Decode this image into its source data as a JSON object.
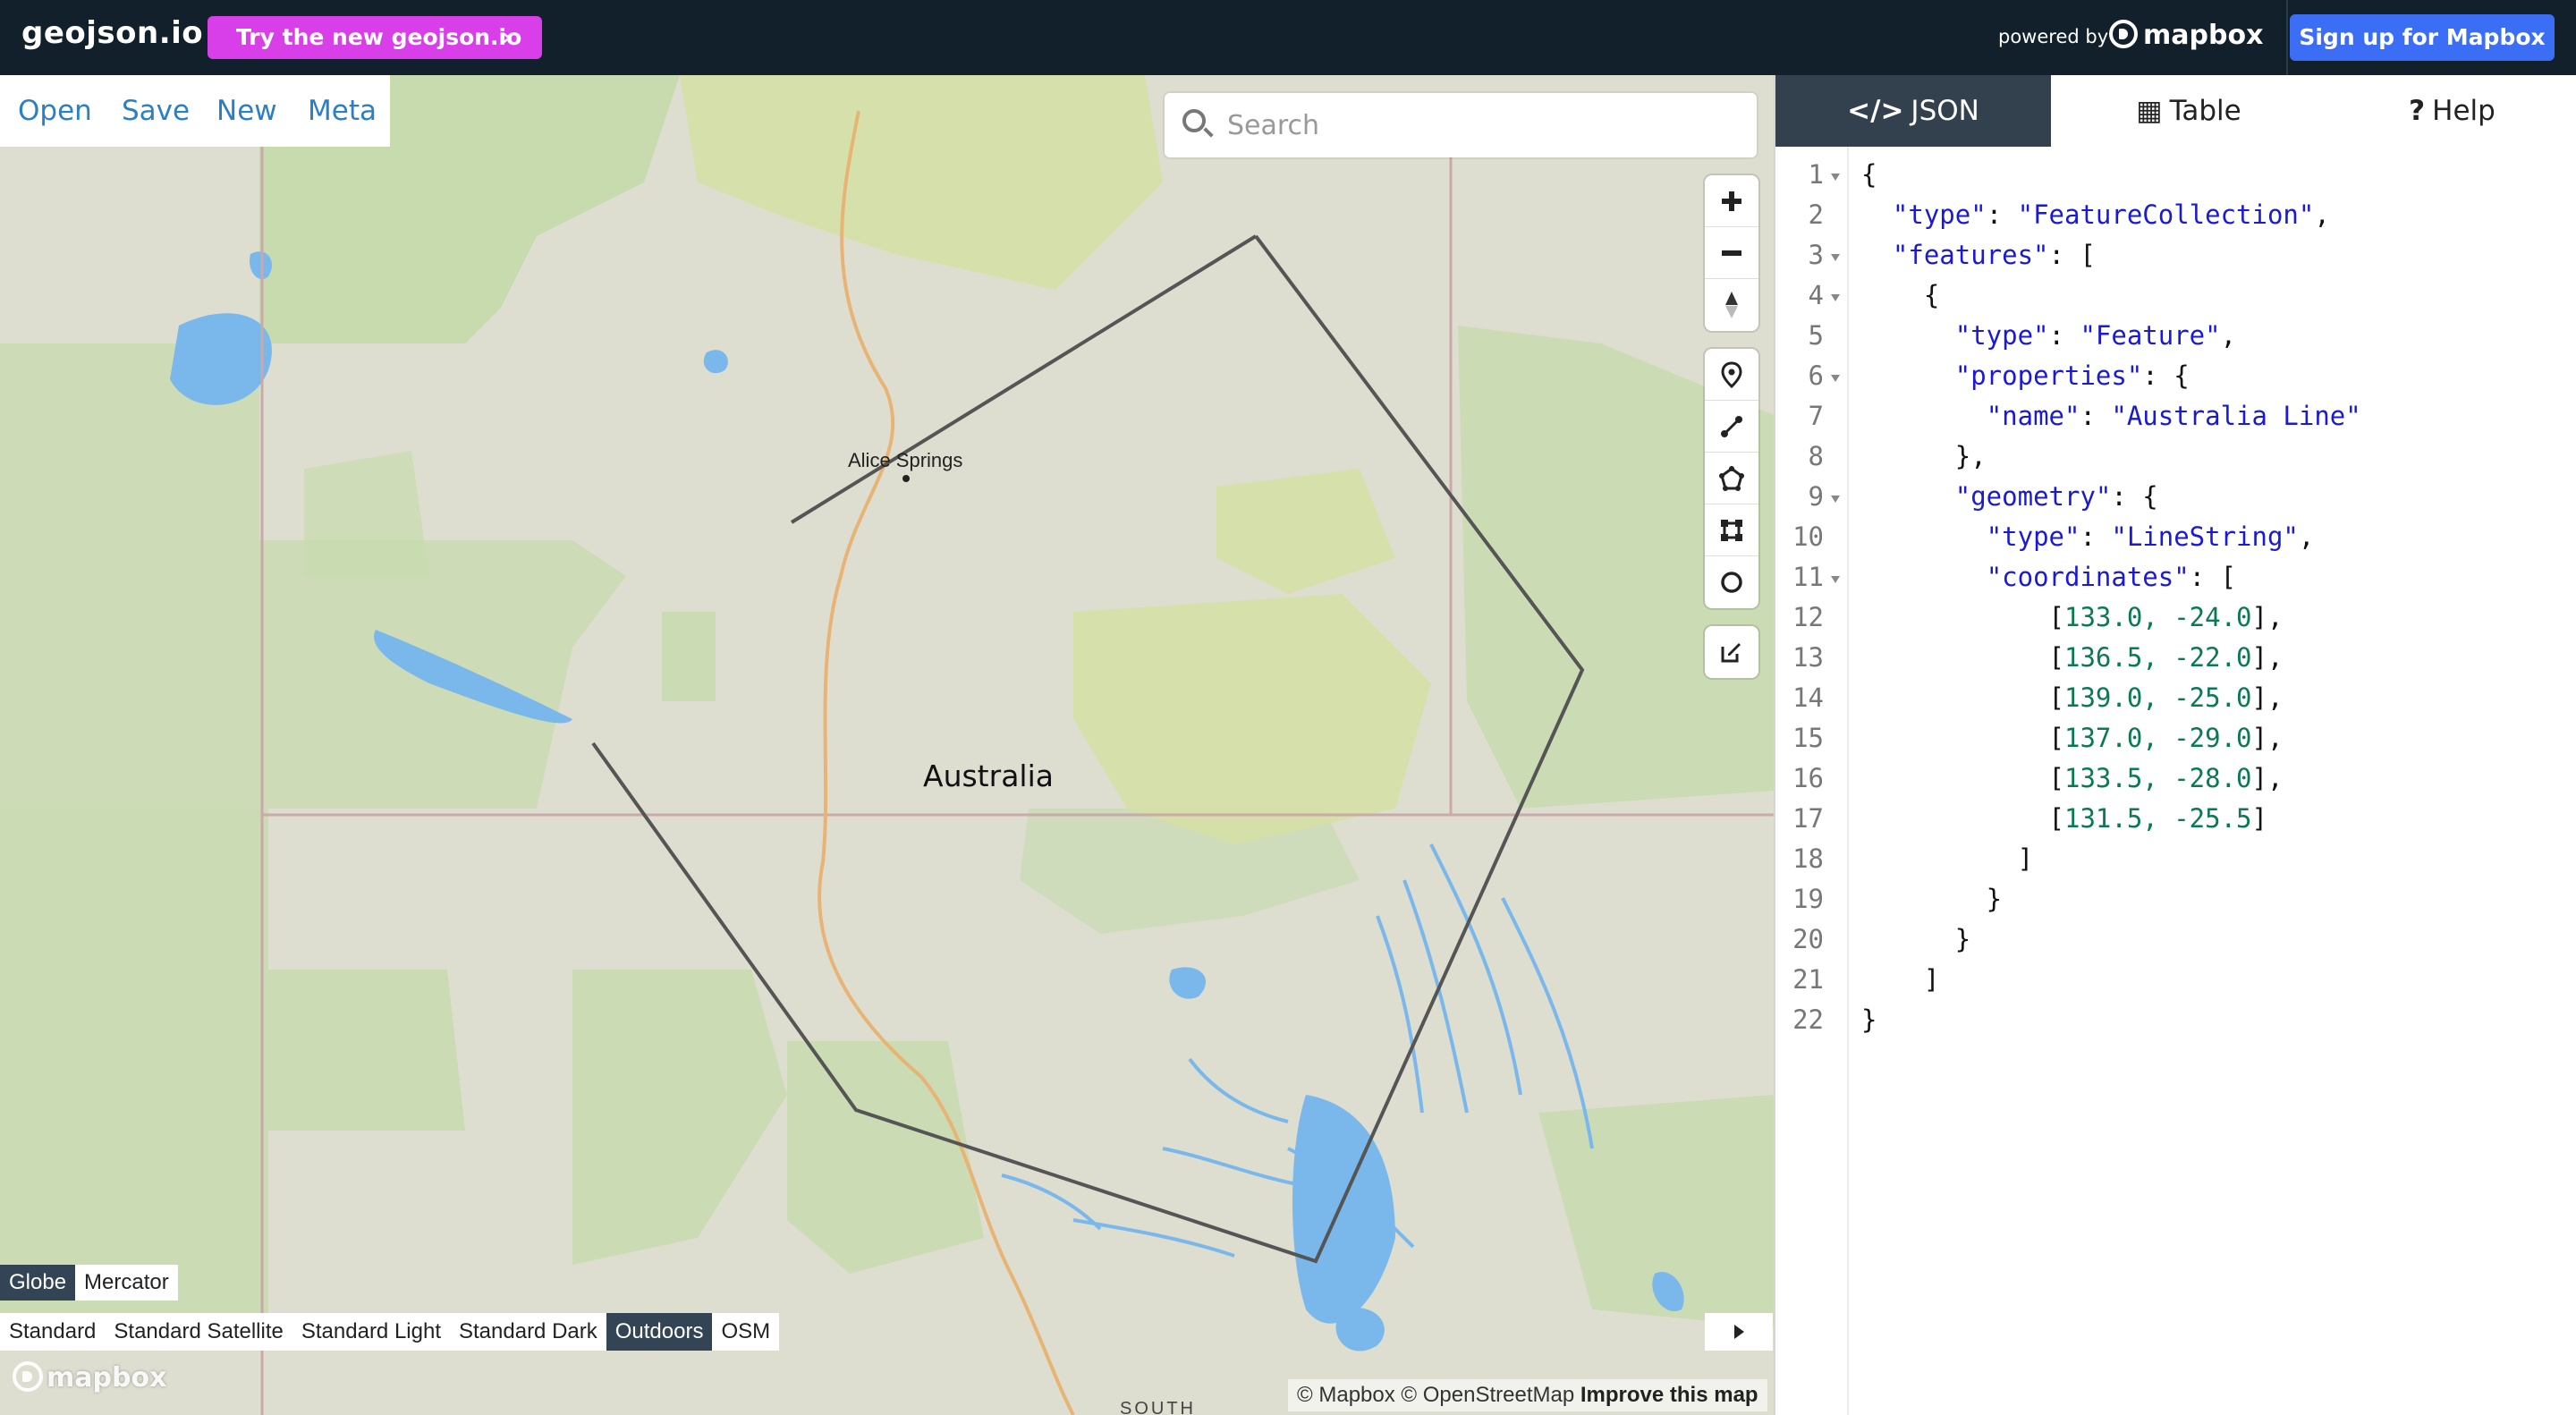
{
  "topbar": {
    "app_title": "geojson.io",
    "try_button": "Try the new geojson.io",
    "powered_by": "powered by",
    "mapbox_logo_text": "mapbox",
    "signup_button": "Sign up for Mapbox",
    "colors": {
      "bar": "#12202b",
      "try": "#d93fe8",
      "signup": "#3b6ef5"
    }
  },
  "file_menu": {
    "open": "Open",
    "save": "Save",
    "new": "New",
    "meta": "Meta"
  },
  "search": {
    "placeholder": "Search",
    "value": ""
  },
  "map": {
    "labels": {
      "city": "Alice Springs",
      "country": "Australia",
      "bottom": "SOUTH"
    },
    "projection": {
      "globe": "Globe",
      "mercator": "Mercator",
      "active": "Globe"
    },
    "styles": [
      "Standard",
      "Standard Satellite",
      "Standard Light",
      "Standard Dark",
      "Outdoors",
      "OSM"
    ],
    "active_style": "Outdoors",
    "watermark": "mapbox",
    "attribution": {
      "mapbox": "© Mapbox",
      "osm": "© OpenStreetMap",
      "improve": "Improve this map"
    },
    "controls": [
      "zoom-in-icon",
      "zoom-out-icon",
      "compass-icon",
      "marker-icon",
      "line-icon",
      "polygon-icon",
      "rectangle-icon",
      "circle-icon",
      "edit-icon"
    ]
  },
  "sidebar": {
    "tabs": {
      "json": "JSON",
      "table": "Table",
      "help": "Help",
      "active": "JSON"
    },
    "line_numbers": [
      "1",
      "2",
      "3",
      "4",
      "5",
      "6",
      "7",
      "8",
      "9",
      "10",
      "11",
      "12",
      "13",
      "14",
      "15",
      "16",
      "17",
      "18",
      "19",
      "20",
      "21",
      "22"
    ],
    "json_text": {
      "type_key": "\"type\"",
      "fc": "\"FeatureCollection\"",
      "features_key": "\"features\"",
      "feature": "\"Feature\"",
      "properties_key": "\"properties\"",
      "name_key": "\"name\"",
      "name_val": "\"Australia Line\"",
      "geometry_key": "\"geometry\"",
      "linestring": "\"LineString\"",
      "coordinates_key": "\"coordinates\"",
      "coords": [
        "133.0, -24.0",
        "136.5, -22.0",
        "139.0, -25.0",
        "137.0, -29.0",
        "133.5, -28.0",
        "131.5, -25.5"
      ]
    }
  }
}
